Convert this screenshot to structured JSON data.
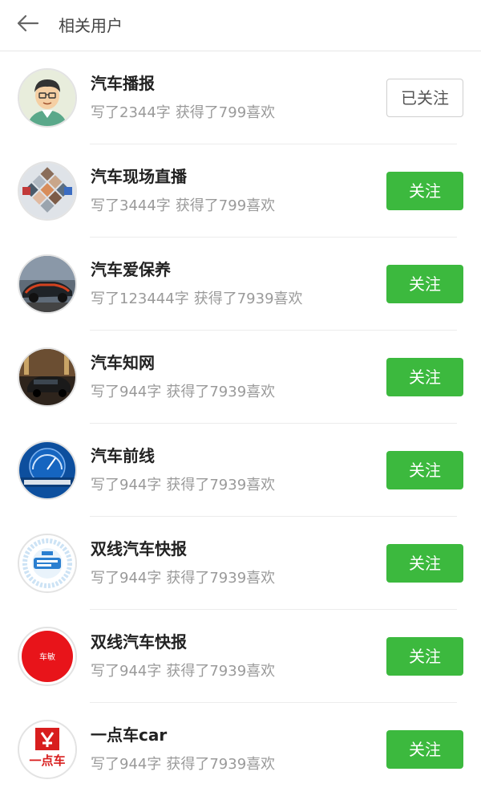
{
  "header": {
    "title": "相关用户"
  },
  "users": [
    {
      "name": "汽车播报",
      "written": "写了2344字",
      "likes": "获得了799喜欢",
      "button": "已关注",
      "followed": true,
      "avatar": "cartoon-man"
    },
    {
      "name": "汽车现场直播",
      "written": "写了3444字",
      "likes": "获得了799喜欢",
      "button": "关注",
      "followed": false,
      "avatar": "photo-collage"
    },
    {
      "name": "汽车爱保养",
      "written": "写了123444字",
      "likes": "获得了7939喜欢",
      "button": "关注",
      "followed": false,
      "avatar": "sports-car"
    },
    {
      "name": "汽车知网",
      "written": "写了944字",
      "likes": "获得了7939喜欢",
      "button": "关注",
      "followed": false,
      "avatar": "luxury-car"
    },
    {
      "name": "汽车前线",
      "written": "写了944字",
      "likes": "获得了7939喜欢",
      "button": "关注",
      "followed": false,
      "avatar": "speedometer-logo"
    },
    {
      "name": "双线汽车快报",
      "written": "写了944字",
      "likes": "获得了7939喜欢",
      "button": "关注",
      "followed": false,
      "avatar": "blue-ring-logo"
    },
    {
      "name": "双线汽车快报",
      "written": "写了944字",
      "likes": "获得了7939喜欢",
      "button": "关注",
      "followed": false,
      "avatar": "red-circle-logo",
      "avatar_text": "车敏"
    },
    {
      "name": "一点车car",
      "written": "写了944字",
      "likes": "获得了7939喜欢",
      "button": "关注",
      "followed": false,
      "avatar": "yidianche-logo",
      "avatar_text": "一点车"
    }
  ],
  "colors": {
    "follow_green": "#3cb93e",
    "stats_gray": "#9a9a9a"
  }
}
